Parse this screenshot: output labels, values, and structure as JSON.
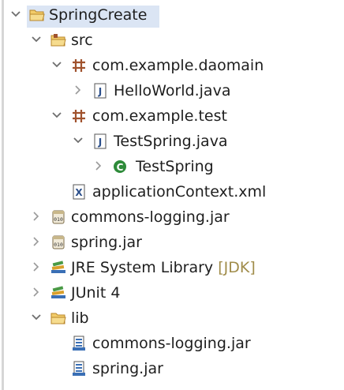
{
  "colors": {
    "selection": "#dbe5f4",
    "text": "#1e1e1e",
    "decoration": "#a08c4a",
    "twisty": "#6e6e6e",
    "folder": "#e9b64c",
    "package": "#a0522d",
    "class": "#2e8b3a"
  },
  "tree": {
    "project": {
      "label": "SpringCreate",
      "icon": "project-folder-icon"
    },
    "src": {
      "label": "src",
      "icon": "source-folder-icon"
    },
    "pkg_domain": {
      "label": "com.example.daomain",
      "icon": "package-icon"
    },
    "helloworld": {
      "label": "HelloWorld.java",
      "icon": "java-file-icon"
    },
    "pkg_test": {
      "label": "com.example.test",
      "icon": "package-icon"
    },
    "testspring_java": {
      "label": "TestSpring.java",
      "icon": "java-file-icon"
    },
    "testspring_class": {
      "label": "TestSpring",
      "icon": "class-icon"
    },
    "appcontext": {
      "label": "applicationContext.xml",
      "icon": "xml-file-icon"
    },
    "commons_logging": {
      "label": "commons-logging.jar",
      "icon": "jar-icon"
    },
    "spring": {
      "label": "spring.jar",
      "icon": "jar-icon"
    },
    "jre": {
      "label": "JRE System Library",
      "decoration": "[JDK]",
      "icon": "library-icon"
    },
    "junit": {
      "label": "JUnit 4",
      "icon": "library-icon"
    },
    "lib": {
      "label": "lib",
      "icon": "folder-icon"
    },
    "lib_commons_logging": {
      "label": "commons-logging.jar",
      "icon": "jar-file-icon"
    },
    "lib_spring": {
      "label": "spring.jar",
      "icon": "jar-file-icon"
    }
  }
}
